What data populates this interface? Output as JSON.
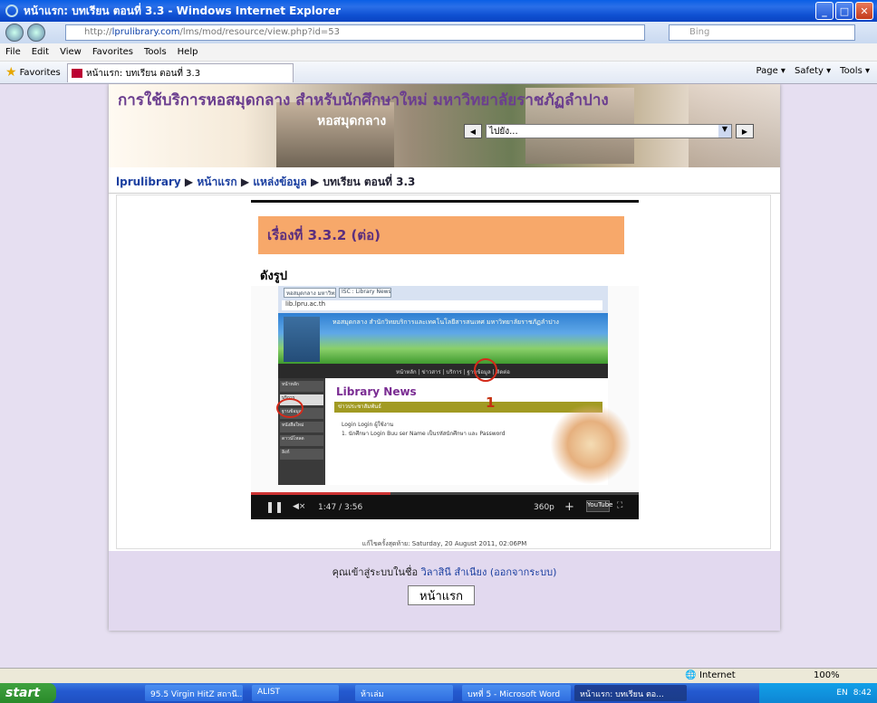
{
  "window": {
    "title": "หน้าแรก: บทเรียน ตอนที่ 3.3 - Windows Internet Explorer"
  },
  "address": {
    "url_prefix": "http://",
    "url_host": "lprulibrary.com",
    "url_path": "/lms/mod/resource/view.php?id=53",
    "search_placeholder": "Bing"
  },
  "menu": [
    "File",
    "Edit",
    "View",
    "Favorites",
    "Tools",
    "Help"
  ],
  "favorites": {
    "label": "Favorites",
    "tab_title": "หน้าแรก: บทเรียน ตอนที่ 3.3"
  },
  "toolbar": {
    "page": "Page ▾",
    "safety": "Safety ▾",
    "tools": "Tools ▾"
  },
  "site": {
    "banner_title": "การใช้บริการหอสมุดกลาง สำหรับนักศึกษาใหม่ มหาวิทยาลัยราชภัฏลำปาง",
    "banner_sub": "หอสมุดกลาง",
    "jump_value": "ไปยัง...",
    "breadcrumb": [
      "lprulibrary",
      "หน้าแรก",
      "แหล่งข้อมูล",
      "บทเรียน ตอนที่ 3.3"
    ]
  },
  "lesson": {
    "heading": "เรื่องที่ 3.3.2 (ต่อ)",
    "text": "ดังรูป",
    "inner": {
      "tab1": "หอสมุดกลาง มหาวิทยาลัย...",
      "tab2": "ISC : Library News",
      "url": "lib.lpru.ac.th",
      "banner_text": "หอสมุดกลาง สำนักวิทยบริการและเทคโนโลยีสารสนเทศ มหาวิทยาลัยราชภัฏลำปาง",
      "nav_text": "หน้าหลัก | ข่าวสาร | บริการ | ฐานข้อมูล | ติดต่อ",
      "menu": [
        "หน้าหลัก",
        "บริการ",
        "ฐานข้อมูล",
        "หนังสือใหม่",
        "ดาวน์โหลด",
        "ลิงก์"
      ],
      "news_title": "Library News",
      "news_bar": "ข่าวประชาสัมพันธ์",
      "news_line1": "Login Login ผู้ใช้งาน",
      "news_line2": "1. นักศึกษา Login Buu ser Name เป็นรหัสนักศึกษา และ Password",
      "mark": "1"
    },
    "player": {
      "time": "1:47 / 3:56",
      "quality": "360p",
      "brand": "YouTube",
      "progress": 0.36
    }
  },
  "modified": "แก้ไขครั้งสุดท้าย: Saturday, 20 August 2011, 02:06PM",
  "footer": {
    "login_prefix": "คุณเข้าสู่ระบบในชื่อ",
    "user": "วิลาสินี สำเนียง",
    "logout": "(ออกจากระบบ)",
    "home_button": "หน้าแรก"
  },
  "status": {
    "zone": "Internet",
    "zoom": "100%"
  },
  "taskbar": {
    "start": "start",
    "items": [
      "95.5 Virgin HitZ สถานี...",
      "ALIST",
      "ห้าเล่ม",
      "บทที่ 5 - Microsoft Word",
      "หน้าแรก: บทเรียน ตอ..."
    ],
    "lang": "EN",
    "clock": "8:42"
  }
}
